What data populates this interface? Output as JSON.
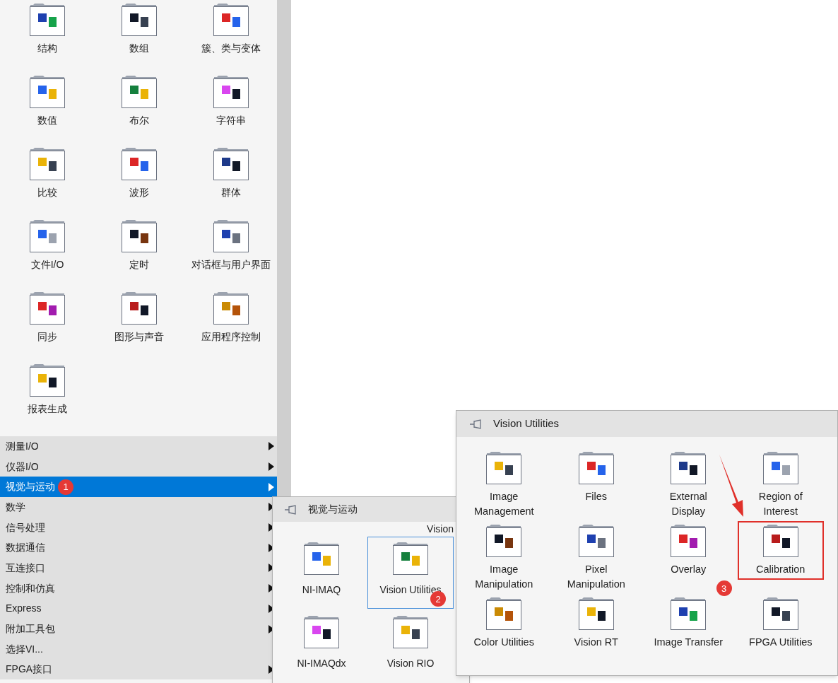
{
  "functions_palette": {
    "items": [
      {
        "label": "结构"
      },
      {
        "label": "数组"
      },
      {
        "label": "簇、类与变体"
      },
      {
        "label": "数值"
      },
      {
        "label": "布尔"
      },
      {
        "label": "字符串"
      },
      {
        "label": "比较"
      },
      {
        "label": "波形"
      },
      {
        "label": "群体"
      },
      {
        "label": "文件I/O"
      },
      {
        "label": "定时"
      },
      {
        "label": "对话框与用户界面"
      },
      {
        "label": "同步"
      },
      {
        "label": "图形与声音"
      },
      {
        "label": "应用程序控制"
      },
      {
        "label": "报表生成"
      }
    ],
    "categories": [
      {
        "label": "测量I/O",
        "submenu": true,
        "selected": false
      },
      {
        "label": "仪器I/O",
        "submenu": true,
        "selected": false
      },
      {
        "label": "视觉与运动",
        "submenu": true,
        "selected": true,
        "badge": "1"
      },
      {
        "label": "数学",
        "submenu": true,
        "selected": false
      },
      {
        "label": "信号处理",
        "submenu": true,
        "selected": false
      },
      {
        "label": "数据通信",
        "submenu": true,
        "selected": false
      },
      {
        "label": "互连接口",
        "submenu": true,
        "selected": false
      },
      {
        "label": "控制和仿真",
        "submenu": true,
        "selected": false
      },
      {
        "label": "Express",
        "submenu": true,
        "selected": false
      },
      {
        "label": "附加工具包",
        "submenu": true,
        "selected": false
      },
      {
        "label": "选择VI...",
        "submenu": false,
        "selected": false
      },
      {
        "label": "FPGA接口",
        "submenu": true,
        "selected": false
      }
    ]
  },
  "vision_motion_palette": {
    "title": "视觉与运动",
    "partial_label": "Vision",
    "items": [
      {
        "label": "NI-IMAQ",
        "selected": false
      },
      {
        "label": "Vision Utilities",
        "selected": true,
        "badge": "2"
      },
      {
        "label": "NI-IMAQdx",
        "selected": false
      },
      {
        "label": "Vision RIO",
        "selected": false
      }
    ]
  },
  "vision_utilities_palette": {
    "title": "Vision Utilities",
    "items": [
      {
        "label": "Image Management",
        "highlighted": false
      },
      {
        "label": "Files",
        "highlighted": false
      },
      {
        "label": "External Display",
        "highlighted": false
      },
      {
        "label": "Region of Interest",
        "highlighted": false
      },
      {
        "label": "Image Manipulation",
        "highlighted": false
      },
      {
        "label": "Pixel Manipulation",
        "highlighted": false
      },
      {
        "label": "Overlay",
        "highlighted": false
      },
      {
        "label": "Calibration",
        "highlighted": true,
        "badge": "3"
      },
      {
        "label": "Color Utilities",
        "highlighted": false
      },
      {
        "label": "Vision RT",
        "highlighted": false
      },
      {
        "label": "Image Transfer",
        "highlighted": false
      },
      {
        "label": "FPGA Utilities",
        "highlighted": false
      }
    ]
  }
}
